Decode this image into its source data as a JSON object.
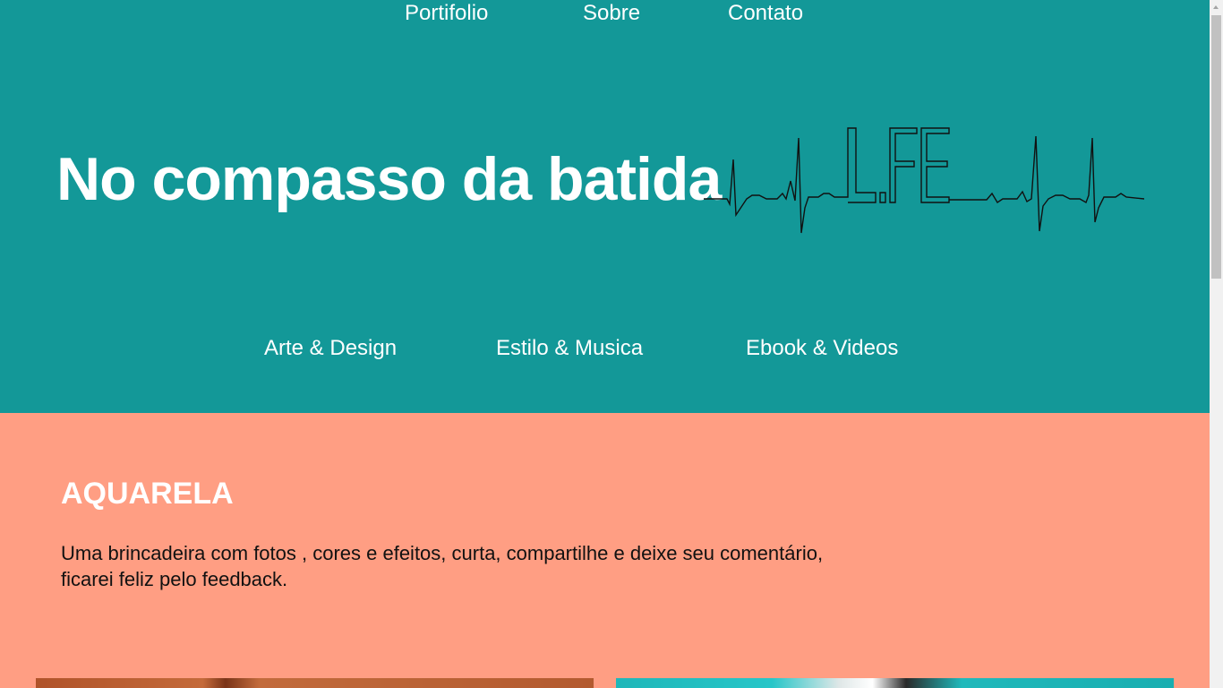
{
  "top_nav": {
    "items": [
      {
        "label": "Portifolio"
      },
      {
        "label": "Sobre"
      },
      {
        "label": "Contato"
      }
    ]
  },
  "hero": {
    "title": "No compasso da batida",
    "logo_text": "LIFE",
    "background": "#139898"
  },
  "category_nav": {
    "items": [
      {
        "label": "Arte & Design"
      },
      {
        "label": "Estilo & Musica"
      },
      {
        "label": "Ebook & Videos"
      }
    ]
  },
  "section": {
    "title": "AQUARELA",
    "text": "Uma brincadeira com fotos , cores e efeitos, curta, compartilhe e deixe seu comentário, ficarei feliz pelo feedback.",
    "background": "#ff9e83"
  },
  "icons": {
    "heartbeat": "heartbeat-life-icon",
    "scroll_up": "chevron-up-icon"
  }
}
